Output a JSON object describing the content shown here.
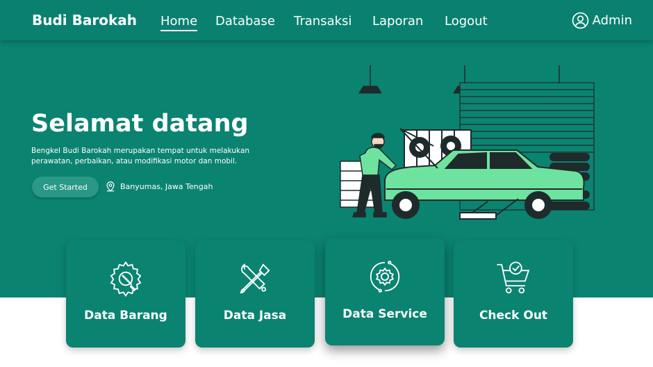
{
  "brand": "Budi Barokah",
  "nav": {
    "home": "Home",
    "database": "Database",
    "transaksi": "Transaksi",
    "laporan": "Laporan",
    "logout": "Logout",
    "user": "Admin"
  },
  "hero": {
    "title": "Selamat datang",
    "description": "Bengkel Budi Barokah merupakan tempat untuk melakukan perawatan, perbaikan, atau modifikasi motor dan mobil.",
    "cta": "Get Started",
    "location": "Banyumas, Jawa Tengah"
  },
  "cards": [
    {
      "label": "Data Barang",
      "icon": "gear-wrench-icon"
    },
    {
      "label": "Data Jasa",
      "icon": "tools-icon"
    },
    {
      "label": "Data Service",
      "icon": "service-gear-icon"
    },
    {
      "label": "Check Out",
      "icon": "cart-check-icon"
    }
  ],
  "colors": {
    "primary": "#0b8371",
    "car_green": "#6ee3a0",
    "background": "#ffffff"
  }
}
